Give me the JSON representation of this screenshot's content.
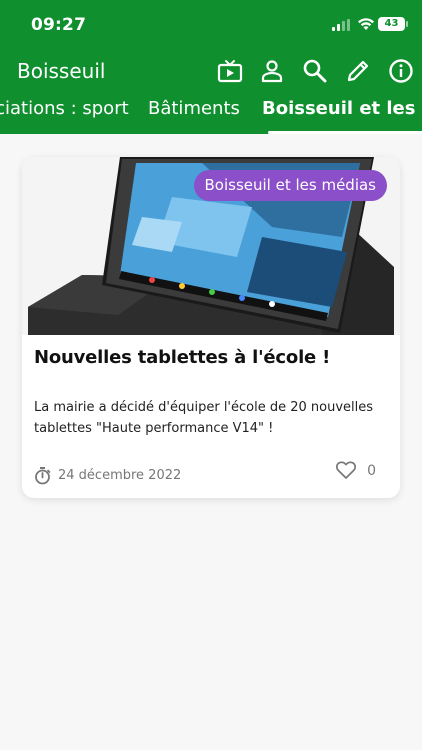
{
  "status_bar": {
    "time": "09:27",
    "battery": "43"
  },
  "app_bar": {
    "title": "Boisseuil",
    "icons": [
      "tv-icon",
      "person-icon",
      "search-icon",
      "edit-icon",
      "info-icon"
    ]
  },
  "tabs": [
    {
      "label": "Associations : sport",
      "active": false
    },
    {
      "label": "Bâtiments",
      "active": false
    },
    {
      "label": "Boisseuil et les médias",
      "active": true
    }
  ],
  "article": {
    "category": "Boisseuil et les médias",
    "title": "Nouvelles tablettes à l'école !",
    "description": "La mairie a décidé d'équiper l'école de 20 nouvelles tablettes \"Haute performance V14\" !",
    "date": "24 décembre 2022",
    "likes": "0"
  },
  "colors": {
    "primary": "#0f8f2e",
    "badge": "#8a4fc9",
    "background": "#f7f7f7"
  }
}
